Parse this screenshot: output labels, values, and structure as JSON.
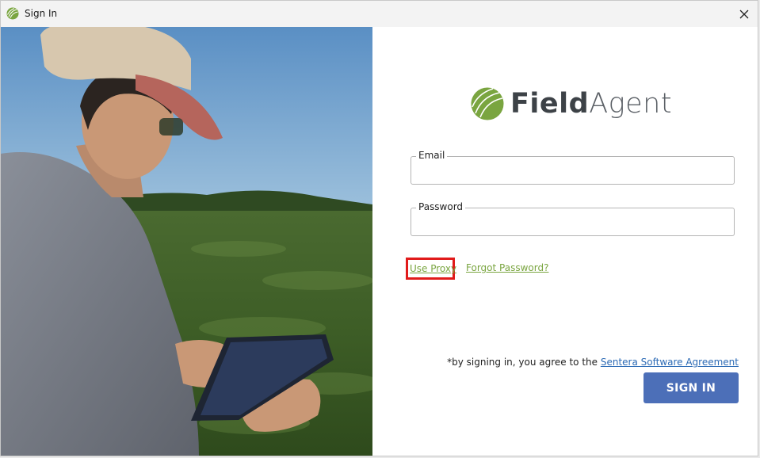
{
  "window": {
    "title": "Sign In",
    "close_icon": "close-icon"
  },
  "photo": {
    "description_icon": "hero-photo-farmer-with-tablet"
  },
  "logo": {
    "text_part1": "Field",
    "text_part2": "Agent",
    "brand_color": "#7aa540"
  },
  "form": {
    "email_label": "Email",
    "email_value": "",
    "password_label": "Password",
    "password_value": "",
    "use_proxy_label": "Use Proxy",
    "forgot_password_label": "Forgot Password?",
    "agreement_prefix": "*by signing in, you agree to the ",
    "agreement_link": "Sentera Software Agreement",
    "signin_label": "SIGN IN"
  },
  "colors": {
    "accent_green": "#7aa540",
    "button_blue": "#4c6fb8",
    "highlight_red": "#e11b1b",
    "link_blue": "#2d6bb5"
  }
}
